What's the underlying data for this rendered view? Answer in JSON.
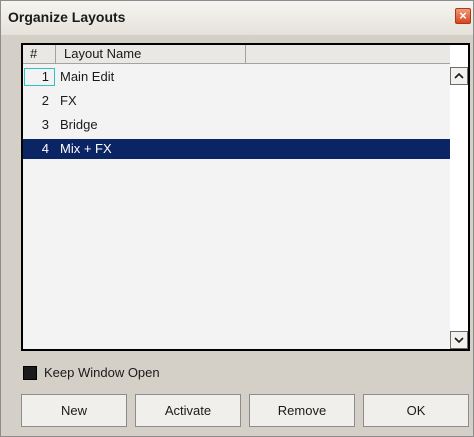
{
  "window": {
    "title": "Organize Layouts",
    "close_glyph": "×"
  },
  "table": {
    "headers": [
      "#",
      "Layout Name",
      ""
    ],
    "rows": [
      {
        "num": "1",
        "name": "Main Edit",
        "focused": true,
        "selected": false
      },
      {
        "num": "2",
        "name": "FX",
        "focused": false,
        "selected": false
      },
      {
        "num": "3",
        "name": "Bridge",
        "focused": false,
        "selected": false
      },
      {
        "num": "4",
        "name": "Mix + FX",
        "focused": false,
        "selected": true
      }
    ]
  },
  "options": {
    "keep_window_open_label": "Keep Window Open",
    "keep_window_open_checked": true
  },
  "buttons": {
    "new": "New",
    "activate": "Activate",
    "remove": "Remove",
    "ok": "OK"
  },
  "colors": {
    "selection": "#0b2463",
    "focus_outline": "#2ec4c4",
    "close_button": "#d9441e"
  }
}
